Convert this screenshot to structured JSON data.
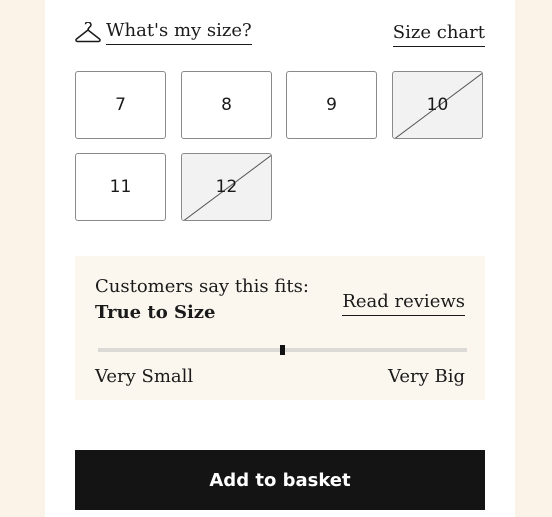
{
  "size_help": {
    "icon": "hanger-icon",
    "label": "What's my size?"
  },
  "size_chart": {
    "label": "Size chart"
  },
  "sizes": [
    {
      "label": "7",
      "available": true
    },
    {
      "label": "8",
      "available": true
    },
    {
      "label": "9",
      "available": true
    },
    {
      "label": "10",
      "available": false
    },
    {
      "label": "11",
      "available": true
    },
    {
      "label": "12",
      "available": false
    }
  ],
  "fit": {
    "lead": "Customers say this fits:",
    "value": "True to Size",
    "reviews_link": "Read reviews",
    "scale_min": "Very Small",
    "scale_max": "Very Big",
    "level": 0.5
  },
  "basket": {
    "label": "Add to basket"
  },
  "colors": {
    "page_bg": "#fbf3e7",
    "panel_bg": "#ffffff",
    "fit_bg": "#fbf6ee",
    "button_bg": "#141414"
  }
}
